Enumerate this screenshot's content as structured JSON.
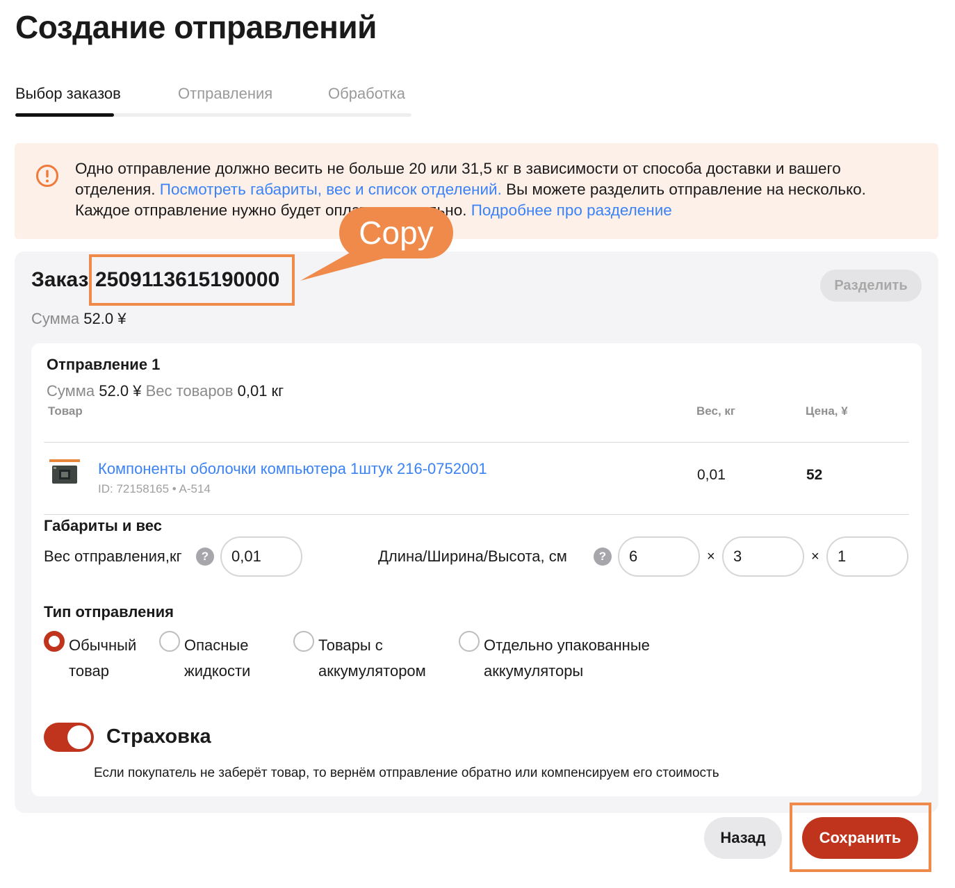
{
  "page": {
    "title": "Создание отправлений"
  },
  "tabs": [
    {
      "label": "Выбор заказов",
      "active": true
    },
    {
      "label": "Отправления",
      "active": false
    },
    {
      "label": "Обработка",
      "active": false
    }
  ],
  "alert": {
    "icon": "exclamation-circle-icon",
    "text_1": "Одно отправление должно весить не больше 20 или 31,5 кг в зависимости от способа доставки и вашего отделения. ",
    "link_1": "Посмотреть габариты, вес и список отделений.",
    "text_2": " Вы можете разделить отправление на несколько. Каждое отправление нужно будет оплатить отдельно. ",
    "link_2": "Подробнее про разделение"
  },
  "order": {
    "label": "Заказ",
    "number": "2509113615190000",
    "sum_label": "Сумма",
    "sum_value": "52.0 ¥",
    "split_button": "Разделить"
  },
  "shipment": {
    "title": "Отправление 1",
    "sum_label": "Сумма",
    "sum_value": "52.0 ¥",
    "weight_label": "Вес товаров",
    "weight_value": "0,01 кг",
    "columns": {
      "product": "Товар",
      "weight": "Вес, кг",
      "price": "Цена, ¥"
    },
    "items": [
      {
        "name": "Компоненты оболочки компьютера 1штук 216-0752001",
        "meta": "ID: 72158165 • A-514",
        "weight": "0,01",
        "price": "52"
      }
    ],
    "dimensions": {
      "title": "Габариты и вес",
      "weight_label": "Вес отправления,кг",
      "weight_value": "0,01",
      "dims_label": "Длина/Ширина/Высота, см",
      "length": "6",
      "width": "3",
      "height": "1",
      "help_glyph": "?",
      "times_glyph": "×"
    },
    "shipment_type": {
      "title": "Тип отправления",
      "options": [
        {
          "label": "Обычный\nтовар",
          "selected": true
        },
        {
          "label": "Опасные\nжидкости",
          "selected": false
        },
        {
          "label": "Товары с\nаккумулятором",
          "selected": false
        },
        {
          "label": "Отдельно упакованные\nаккумуляторы",
          "selected": false
        }
      ]
    },
    "insurance": {
      "title": "Страховка",
      "enabled": true,
      "description": "Если покупатель не заберёт товар, то вернём отправление обратно или компенсируем его стоимость"
    }
  },
  "footer": {
    "back_button": "Назад",
    "save_button": "Сохранить"
  },
  "annotation": {
    "callout_text": "Copy"
  },
  "colors": {
    "accent": "#c0341d",
    "link": "#3b82f6",
    "alert_bg": "#fdf0e8",
    "annotation": "#f08a4b"
  }
}
